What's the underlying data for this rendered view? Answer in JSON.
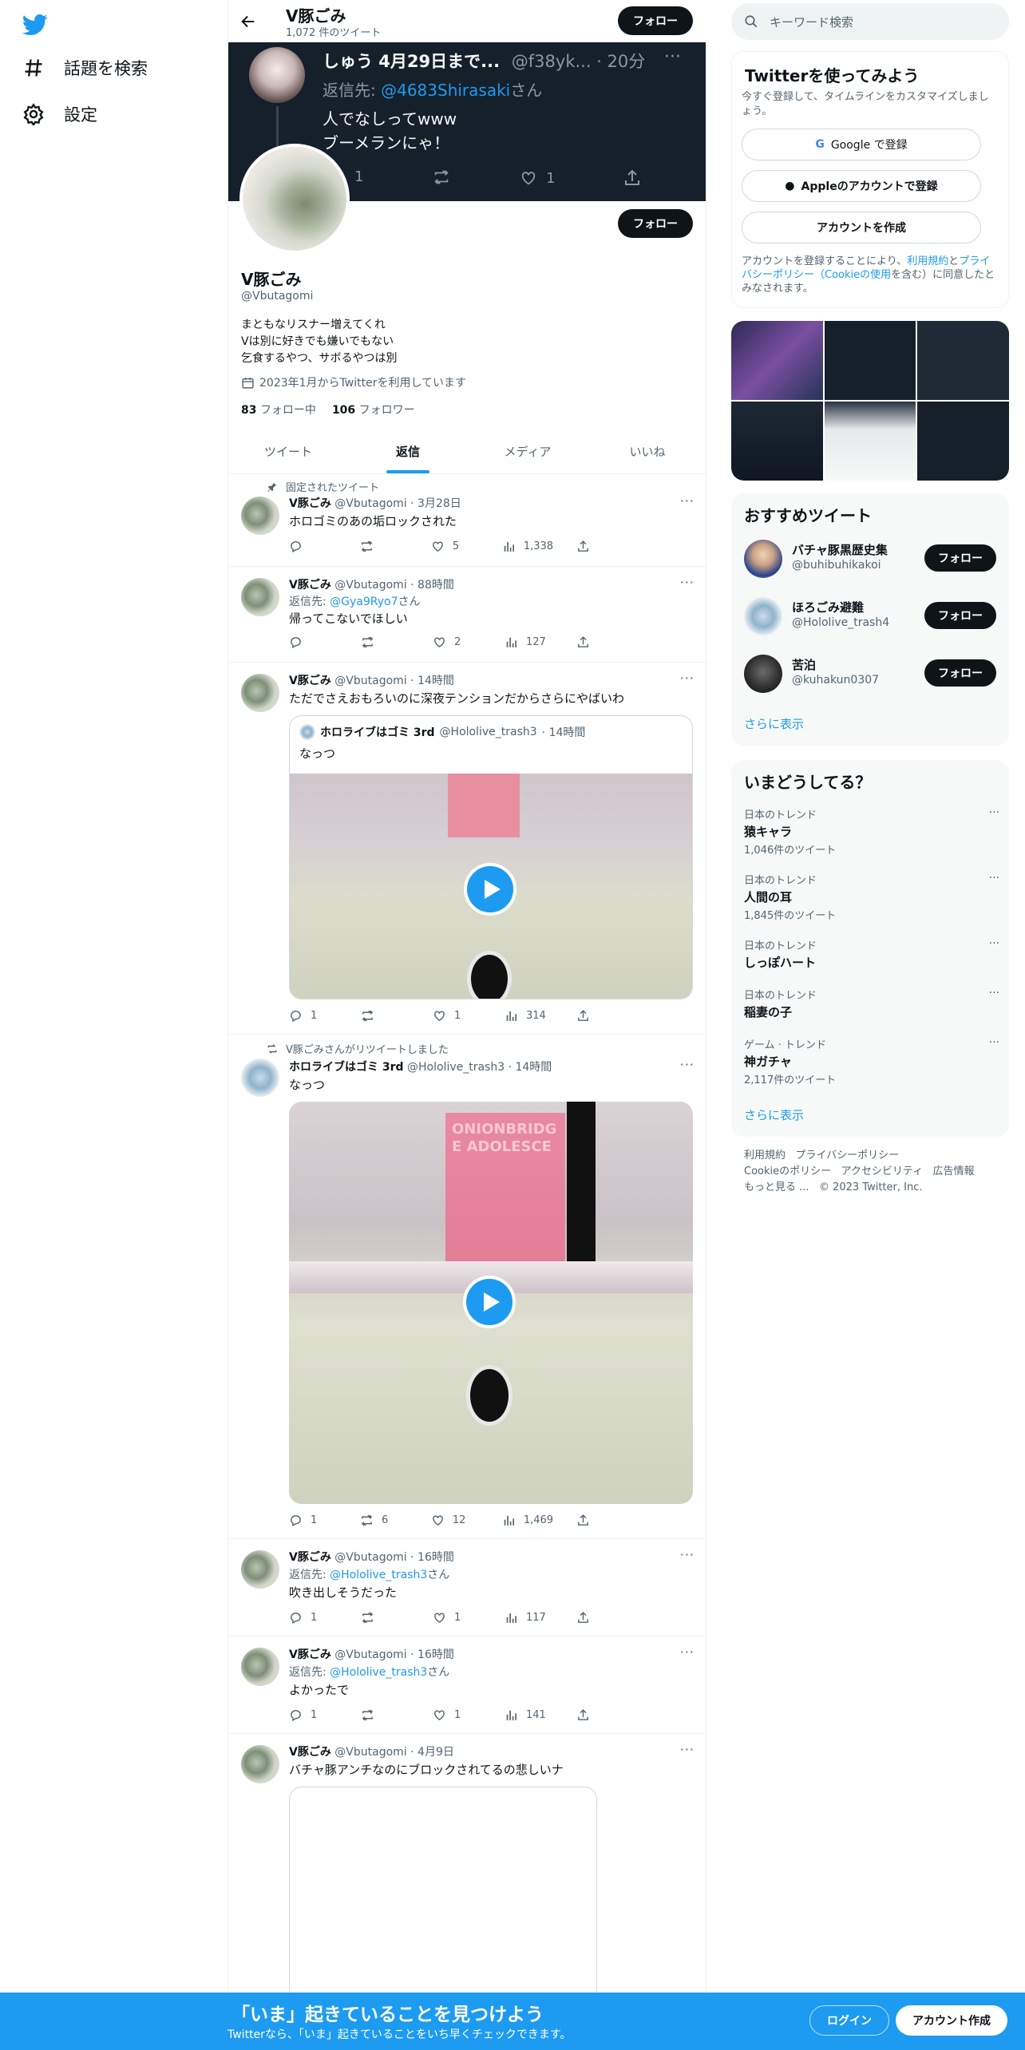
{
  "nav": {
    "explore": "話題を検索",
    "settings": "設定"
  },
  "header": {
    "name": "V豚ごみ",
    "tweet_count": "1,072 件のツイート",
    "follow": "フォロー"
  },
  "banner": {
    "name": "しゅう 4月29日まで...",
    "handle": "@f38yk...",
    "time": "· 20分",
    "reply_prefix": "返信先:",
    "reply_to": "@4683Shirasaki",
    "reply_suffix": "さん",
    "line1": "人でなしってwww",
    "line2": "ブーメランにゃ！",
    "reply_count": "1",
    "like_count": "1"
  },
  "profile": {
    "follow": "フォロー",
    "name": "V豚ごみ",
    "handle": "@Vbutagomi",
    "bio1": "まともなリスナー増えてくれ",
    "bio2": "Vは別に好きでも嫌いでもない",
    "bio3": "乞食するやつ、サボるやつは別",
    "joined": "2023年1月からTwitterを利用しています",
    "following_count": "83",
    "following_label": "フォロー中",
    "followers_count": "106",
    "followers_label": "フォロワー"
  },
  "tabs": [
    "ツイート",
    "返信",
    "メディア",
    "いいね"
  ],
  "tweets": [
    {
      "context": "固定されたツイート",
      "name": "V豚ごみ",
      "handle": "@Vbutagomi",
      "time": "· 3月28日",
      "text": "ホロゴミのあの垢ロックされた",
      "replies": "",
      "retweets": "",
      "likes": "5",
      "views": "1,338"
    },
    {
      "name": "V豚ごみ",
      "handle": "@Vbutagomi",
      "time": "· 88時間",
      "reply_prefix": "返信先:",
      "reply_to": "@Gya9Ryo7",
      "reply_suffix": "さん",
      "text": "帰ってこないでほしい",
      "replies": "",
      "retweets": "",
      "likes": "2",
      "views": "127"
    },
    {
      "name": "V豚ごみ",
      "handle": "@Vbutagomi",
      "time": "· 14時間",
      "text": "ただでさえおもろいのに深夜テンションだからさらにやばいわ",
      "quote_name": "ホロライブはゴミ 3rd",
      "quote_handle": "@Hololive_trash3",
      "quote_time": "· 14時間",
      "quote_text": "なっつ",
      "replies": "1",
      "retweets": "",
      "likes": "1",
      "views": "314"
    },
    {
      "context": "V豚ごみさんがリツイートしました",
      "name": "ホロライブはゴミ 3rd",
      "handle": "@Hololive_trash3",
      "time": "· 14時間",
      "text": "なっつ",
      "card_text": "ONIONBRIDGE ADOLESCE",
      "replies": "1",
      "retweets": "6",
      "likes": "12",
      "views": "1,469"
    },
    {
      "name": "V豚ごみ",
      "handle": "@Vbutagomi",
      "time": "· 16時間",
      "reply_prefix": "返信先:",
      "reply_to": "@Hololive_trash3",
      "reply_suffix": "さん",
      "text": "吹き出しそうだった",
      "replies": "1",
      "retweets": "",
      "likes": "1",
      "views": "117"
    },
    {
      "name": "V豚ごみ",
      "handle": "@Vbutagomi",
      "time": "· 16時間",
      "reply_prefix": "返信先:",
      "reply_to": "@Hololive_trash3",
      "reply_suffix": "さん",
      "text": "よかったで",
      "replies": "1",
      "retweets": "",
      "likes": "1",
      "views": "141"
    },
    {
      "name": "V豚ごみ",
      "handle": "@Vbutagomi",
      "time": "· 4月9日",
      "text": "バチャ豚アンチなのにブロックされてるの悲しいナ"
    }
  ],
  "sidebar": {
    "search_placeholder": "キーワード検索",
    "signup": {
      "title": "Twitterを使ってみよう",
      "subtitle1": "今すぐ登録して、タイムラインをカスタマイズしまし",
      "subtitle2": "ょう。",
      "google": "Google で登録",
      "apple": "Appleのアカウントで登録",
      "create": "アカウントを作成",
      "terms1": "アカウントを登録することにより、",
      "terms_link1": "利用規約",
      "terms2": "と",
      "terms_link2": "プライ",
      "terms3": "バシーポリシー（Cookieの使用",
      "terms4": "を含む）に同意したと",
      "terms5": "みなされます。"
    },
    "recommend": {
      "title": "おすすめツイート",
      "users": [
        {
          "name": "バチャ豚黒歴史集",
          "handle": "@buhibuhikakoi",
          "follow": "フォロー"
        },
        {
          "name": "ほろごみ避難",
          "handle": "@Hololive_trash4",
          "follow": "フォロー"
        },
        {
          "name": "苦泊",
          "handle": "@kuhakun0307",
          "follow": "フォロー"
        }
      ],
      "more": "さらに表示"
    },
    "trends": {
      "title": "いまどうしてる？",
      "items": [
        {
          "category": "日本のトレンド",
          "name": "猿キャラ",
          "count": "1,046件のツイート"
        },
        {
          "category": "日本のトレンド",
          "name": "人間の耳",
          "count": "1,845件のツイート"
        },
        {
          "category": "日本のトレンド",
          "name": "しっぽハート",
          "count": ""
        },
        {
          "category": "日本のトレンド",
          "name": "稲妻の子",
          "count": ""
        },
        {
          "category": "ゲーム · トレンド",
          "name": "神ガチャ",
          "count": "2,117件のツイート"
        }
      ],
      "more": "さらに表示"
    },
    "footer": {
      "l1": "利用規約",
      "l2": "プライバシーポリシー",
      "l3": "Cookieのポリシー",
      "l4": "アクセシビリティ",
      "l5": "広告情報",
      "l6": "もっと見る ...",
      "l7": "© 2023 Twitter, Inc."
    }
  },
  "bottom_bar": {
    "title": "「いま」起きていることを見つけよう",
    "subtitle": "Twitterなら、「いま」起きていることをいち早くチェックできます。",
    "login": "ログイン",
    "signup": "アカウント作成"
  },
  "colors": {
    "accent": "#1d9bf0",
    "text": "#0f1419",
    "muted": "#536471",
    "bottom_bar": "#1d9bf0"
  }
}
